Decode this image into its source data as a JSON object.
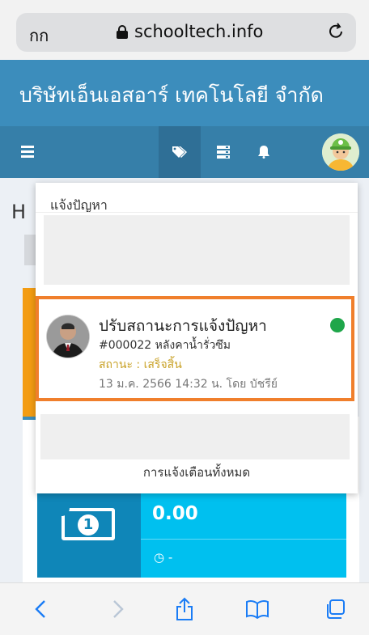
{
  "browser": {
    "aa_label": "กก",
    "url": "schooltech.info"
  },
  "header": {
    "company_name": "บริษัทเอ็นเอสอาร์ เทคโนโลยี จำกัด"
  },
  "page": {
    "heading_partial": "H"
  },
  "notifications": {
    "header": "แจ้งปัญหา",
    "item": {
      "title": "ปรับสถานะการแจ้งปัญหา",
      "ticket": "#000022 หลังคาน้ำรั่วซึม",
      "status": "สถานะ : เสร็จสิ้น",
      "time": "13 ม.ค. 2566 14:32 น. โดย บัชรีย์"
    },
    "footer": "การแจ้งเตือนทั้งหมด"
  },
  "widget": {
    "amount": "0.00",
    "time": "-"
  },
  "colors": {
    "primary": "#3c8dbc",
    "highlight_border": "#f07f2c",
    "status_dot": "#1fa64a",
    "status_text": "#c9a227"
  }
}
